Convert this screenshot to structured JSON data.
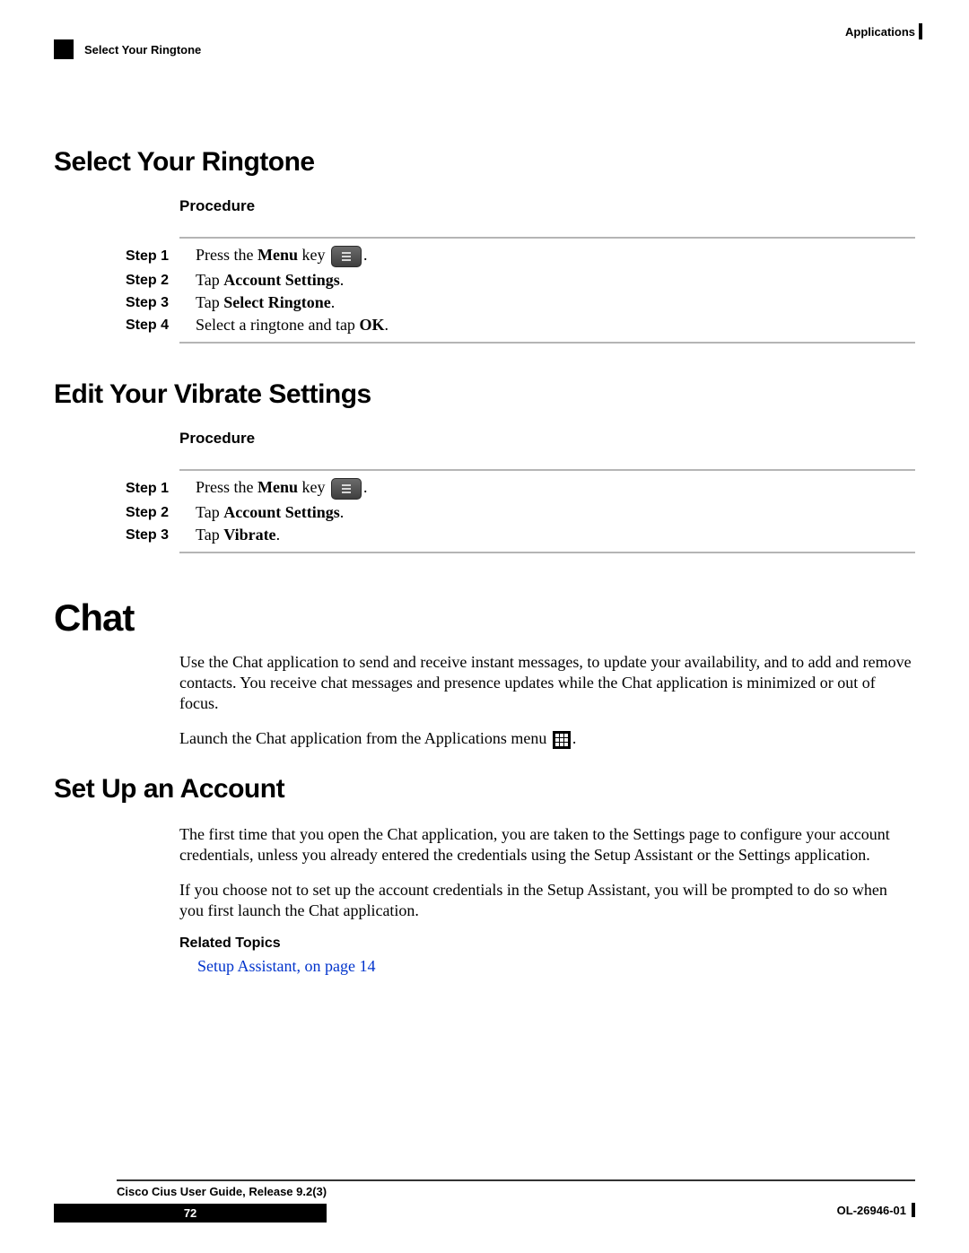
{
  "header": {
    "chapter_label": "Applications",
    "breadcrumb": "Select Your Ringtone"
  },
  "sections": {
    "ringtone": {
      "title": "Select Your Ringtone",
      "procedure_label": "Procedure",
      "steps": {
        "s1_label": "Step 1",
        "s1_a": "Press the ",
        "s1_b": "Menu",
        "s1_c": " key ",
        "s1_d": ".",
        "s2_label": "Step 2",
        "s2_a": "Tap ",
        "s2_b": "Account Settings",
        "s2_c": ".",
        "s3_label": "Step 3",
        "s3_a": "Tap ",
        "s3_b": "Select Ringtone",
        "s3_c": ".",
        "s4_label": "Step 4",
        "s4_a": "Select a ringtone and tap ",
        "s4_b": "OK",
        "s4_c": "."
      }
    },
    "vibrate": {
      "title": "Edit Your Vibrate Settings",
      "procedure_label": "Procedure",
      "steps": {
        "s1_label": "Step 1",
        "s1_a": "Press the ",
        "s1_b": "Menu",
        "s1_c": " key ",
        "s1_d": ".",
        "s2_label": "Step 2",
        "s2_a": "Tap ",
        "s2_b": "Account Settings",
        "s2_c": ".",
        "s3_label": "Step 3",
        "s3_a": "Tap ",
        "s3_b": "Vibrate",
        "s3_c": "."
      }
    },
    "chat": {
      "title": "Chat",
      "para1": "Use the Chat application to send and receive instant messages, to update your availability, and to add and remove contacts. You receive chat messages and presence updates while the Chat application is minimized or out of focus.",
      "para2_a": "Launch the Chat application from the Applications menu ",
      "para2_b": "."
    },
    "setup": {
      "title": "Set Up an Account",
      "para1": "The first time that you open the Chat application, you are taken to the Settings page to configure your account credentials, unless you already entered the credentials using the Setup Assistant or the Settings application.",
      "para2": "If you choose not to set up the account credentials in the Setup Assistant, you will be prompted to do so when you first launch the Chat application.",
      "related_label": "Related Topics",
      "link_text": "Setup Assistant,  on page 14"
    }
  },
  "footer": {
    "doc_title": "Cisco Cius User Guide, Release 9.2(3)",
    "page_number": "72",
    "doc_id": "OL-26946-01"
  }
}
